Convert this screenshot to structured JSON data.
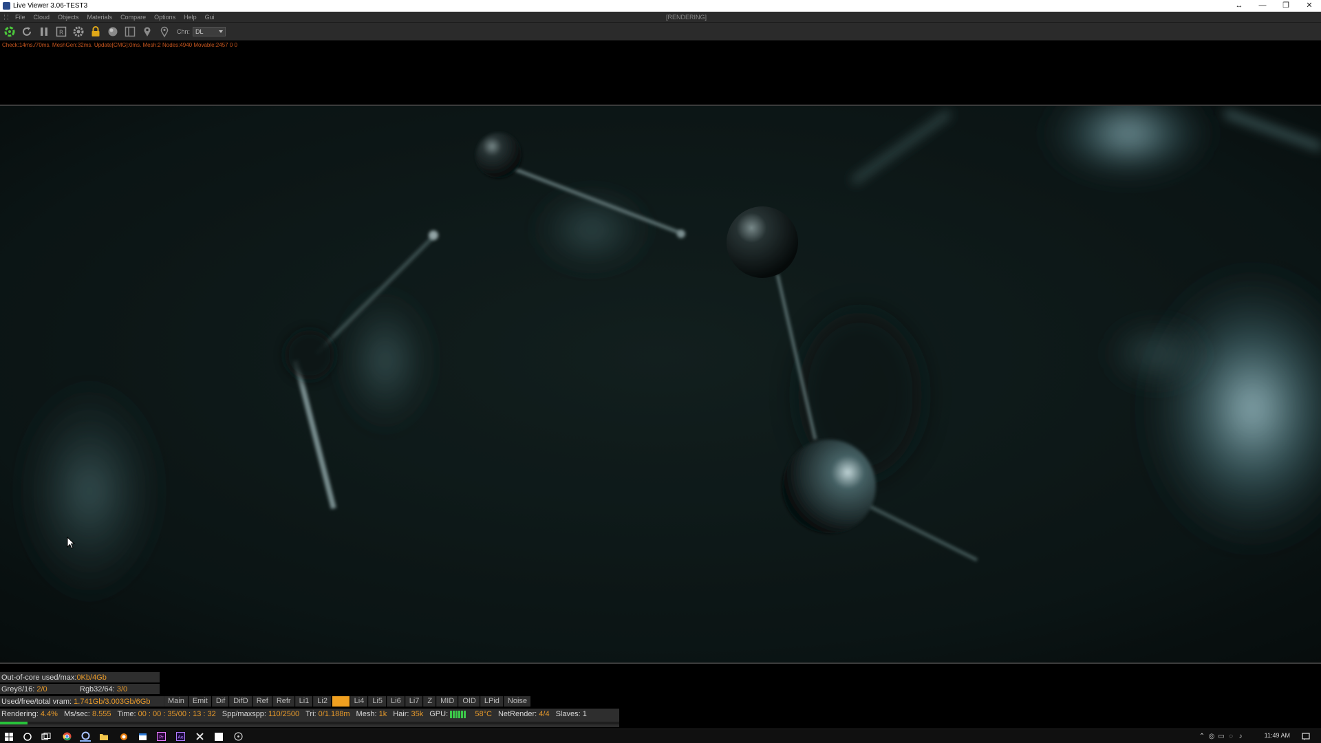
{
  "window": {
    "title": "Live Viewer 3.06-TEST3",
    "controls": [
      "↔",
      "—",
      "❐",
      "✕"
    ]
  },
  "menu": {
    "items": [
      "File",
      "Cloud",
      "Objects",
      "Materials",
      "Compare",
      "Options",
      "Help",
      "Gui"
    ],
    "status": "[RENDERING]"
  },
  "toolbar": {
    "buttons": [
      "recycle-icon",
      "reload-icon",
      "pause-icon",
      "region-icon",
      "settings-icon",
      "lock-icon",
      "sphere-icon",
      "frame-icon",
      "pin-icon",
      "pin-outline-icon"
    ],
    "channel_label": "Chn:",
    "channel_value": "DL"
  },
  "stats_line": "Check:14ms./70ms. MeshGen:32ms. Update[CMG]:0ms. Mesh:2 Nodes:4940 Movable:2457  0 0",
  "info": {
    "outofcore_label": "Out-of-core used/max:",
    "outofcore_value": "0Kb/4Gb",
    "grey_label": "Grey8/16:",
    "grey_value": "2/0",
    "rgb_label": "Rgb32/64:",
    "rgb_value": "3/0",
    "vram_label": "Used/free/total vram:",
    "vram_value": "1.741Gb/3.003Gb/6Gb"
  },
  "passes": {
    "items": [
      "Main",
      "Emit",
      "Dif",
      "DifD",
      "Ref",
      "Refr",
      "Li1",
      "Li2",
      "Li3",
      "Li4",
      "Li5",
      "Li6",
      "Li7",
      "Z",
      "MID",
      "OID",
      "LPid",
      "Noise"
    ],
    "active_index": 8
  },
  "status": {
    "rendering_label": "Rendering:",
    "rendering_value": "4.4%",
    "mssec_label": "Ms/sec:",
    "mssec_value": "8.555",
    "time_label": "Time:",
    "time_value": "00 : 00 : 35/00 : 13 : 32",
    "spp_label": "Spp/maxspp:",
    "spp_value": "110/2500",
    "tri_label": "Tri:",
    "tri_value": "0/1.188m",
    "mesh_label": "Mesh:",
    "mesh_value": "1k",
    "hair_label": "Hair:",
    "hair_value": "35k",
    "gpu_label": "GPU:",
    "gpu_temp": "58°C",
    "net_label": "NetRender:",
    "net_value": "4/4",
    "slaves_label": "Slaves:",
    "slaves_value": "1",
    "progress_fraction": 0.044
  },
  "taskbar": {
    "apps": [
      "windows-start-icon",
      "cortana-icon",
      "task-view-icon",
      "chrome-icon",
      "octane-icon",
      "file-explorer-icon",
      "blender-icon",
      "window-app-icon",
      "premiere-icon",
      "after-effects-icon",
      "tools-icon",
      "white-app-icon",
      "disc-icon"
    ],
    "clock": "11:49 AM"
  },
  "colors": {
    "accent": "#f0a020",
    "value_text": "#e89a2a",
    "progress": "#27c23a",
    "stats_text": "#c8561e"
  }
}
